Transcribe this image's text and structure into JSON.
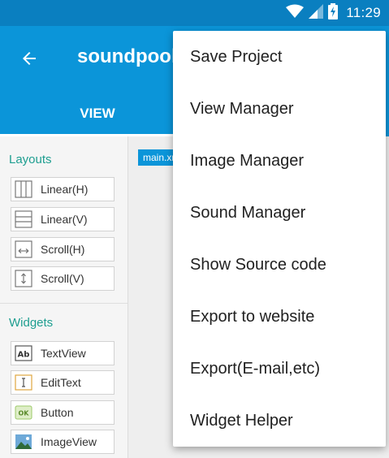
{
  "status_bar": {
    "time": "11:29"
  },
  "app_bar": {
    "title": "soundpool"
  },
  "tabs": [
    {
      "label": "VIEW"
    }
  ],
  "palette": {
    "layouts_title": "Layouts",
    "layouts": [
      {
        "label": "Linear(H)",
        "icon": "linear-h-icon"
      },
      {
        "label": "Linear(V)",
        "icon": "linear-v-icon"
      },
      {
        "label": "Scroll(H)",
        "icon": "scroll-h-icon"
      },
      {
        "label": "Scroll(V)",
        "icon": "scroll-v-icon"
      }
    ],
    "widgets_title": "Widgets",
    "widgets": [
      {
        "label": "TextView",
        "icon": "textview-icon"
      },
      {
        "label": "EditText",
        "icon": "edittext-icon"
      },
      {
        "label": "Button",
        "icon": "button-icon"
      },
      {
        "label": "ImageView",
        "icon": "imageview-icon"
      }
    ]
  },
  "canvas": {
    "file_tab": "main.xml"
  },
  "menu": {
    "items": [
      {
        "label": "Save Project"
      },
      {
        "label": "View Manager"
      },
      {
        "label": "Image Manager"
      },
      {
        "label": "Sound Manager"
      },
      {
        "label": "Show Source code"
      },
      {
        "label": "Export to website"
      },
      {
        "label": "Export(E-mail,etc)"
      },
      {
        "label": "Widget Helper"
      }
    ]
  },
  "colors": {
    "primary": "#0b95d9",
    "status_bar": "#0a7fc0",
    "accent_text": "#1e9e90"
  }
}
